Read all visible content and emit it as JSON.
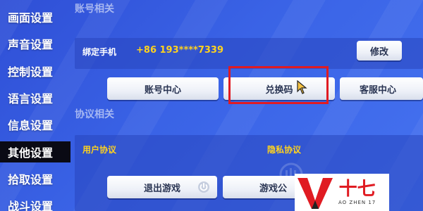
{
  "sidebar": {
    "items": [
      {
        "label": "画面设置"
      },
      {
        "label": "声音设置"
      },
      {
        "label": "控制设置"
      },
      {
        "label": "语言设置"
      },
      {
        "label": "信息设置"
      },
      {
        "label": "其他设置",
        "active": true
      },
      {
        "label": "拾取设置"
      },
      {
        "label": "战斗设置"
      }
    ]
  },
  "account": {
    "section_title": "账号相关",
    "bind_phone_label": "绑定手机",
    "phone_value": "+86 193****7339",
    "modify_button": "修改",
    "account_center_button": "账号中心",
    "redeem_code_button": "兑换码",
    "customer_service_button": "客服中心"
  },
  "protocol": {
    "section_title": "协议相关",
    "user_agreement": "用户协议",
    "privacy_agreement": "隐私协议",
    "exit_game_button": "退出游戏",
    "game_button_partial": "游戏公"
  },
  "logo": {
    "cn": "十七",
    "en": "AO ZHEN 17"
  },
  "colors": {
    "background": "#3a63e6",
    "highlight": "#e01b22",
    "phone_text": "#ffd21e",
    "agreement_text": "#ffd21e",
    "active_sidebar": "#0a0a14"
  }
}
